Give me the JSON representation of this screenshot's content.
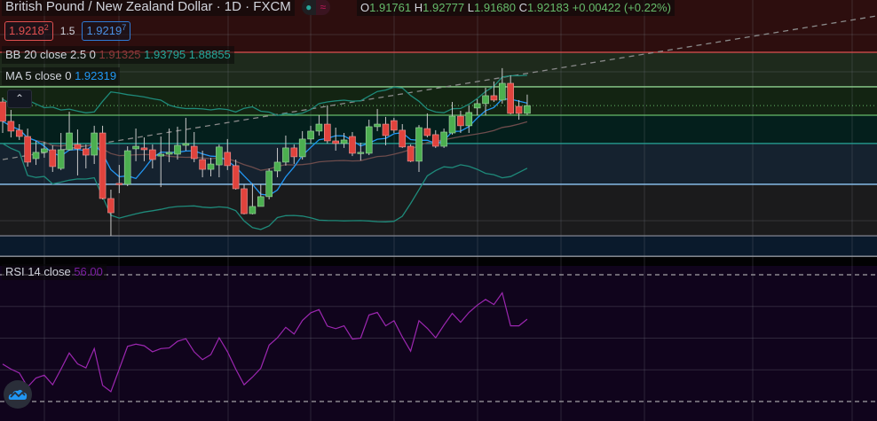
{
  "header": {
    "title": "British Pound / New Zealand Dollar · 1D · FXCM",
    "ohlc": {
      "o_label": "O",
      "o": "1.91761",
      "h_label": "H",
      "h": "1.92777",
      "l_label": "L",
      "l": "1.91680",
      "c_label": "C",
      "c": "1.92183",
      "change": "+0.00422 (+0.22%)"
    }
  },
  "trade": {
    "sell_price": "1.9218",
    "sell_pip": "2",
    "quantity": "1.5",
    "buy_price": "1.9219",
    "buy_pip": "7"
  },
  "indicators": {
    "bb": {
      "label": "BB 20 close 2.5 0",
      "basis": "1.91325",
      "upper": "1.93795",
      "lower": "1.88855"
    },
    "ma": {
      "label": "MA 5 close 0",
      "value": "1.92319"
    },
    "rsi": {
      "label": "RSI 14 close",
      "value": "56.00"
    }
  },
  "colors": {
    "up": "#4caf50",
    "down": "#e0433d",
    "ma": "#2196f3",
    "bb_band": "#1e8a7a",
    "bb_basis": "#6d4c4c",
    "rsi": "#9c27b0"
  },
  "icons": {
    "collapse": "chevron-up-icon",
    "logo": "cloud-chart-icon"
  },
  "chart_data": {
    "type": "candlestick",
    "title": "British Pound / New Zealand Dollar · 1D · FXCM",
    "candles_ohlc": [
      [
        1.9238,
        1.9262,
        1.907,
        1.9133
      ],
      [
        1.9133,
        1.9195,
        1.9046,
        1.908
      ],
      [
        1.9085,
        1.9118,
        1.9032,
        1.9051
      ],
      [
        1.9051,
        1.9094,
        1.8888,
        1.8912
      ],
      [
        1.8931,
        1.9027,
        1.8897,
        1.8965
      ],
      [
        1.8965,
        1.9022,
        1.8936,
        1.8984
      ],
      [
        1.8979,
        1.9003,
        1.8859,
        1.8888
      ],
      [
        1.8878,
        1.907,
        1.8869,
        1.8979
      ],
      [
        1.8979,
        1.9185,
        1.8974,
        1.907
      ],
      [
        1.9008,
        1.9089,
        1.884,
        1.8984
      ],
      [
        1.8984,
        1.9008,
        1.8878,
        1.895
      ],
      [
        1.895,
        1.9109,
        1.8902,
        1.907
      ],
      [
        1.907,
        1.9109,
        1.871,
        1.8715
      ],
      [
        1.8715,
        1.8763,
        1.8513,
        1.8638
      ],
      [
        1.8797,
        1.8897,
        1.8744,
        1.8792
      ],
      [
        1.8792,
        1.8998,
        1.8782,
        1.8974
      ],
      [
        1.8984,
        1.9094,
        1.8917,
        1.8998
      ],
      [
        1.8989,
        1.9046,
        1.8917,
        1.8979
      ],
      [
        1.8979,
        1.9008,
        1.8878,
        1.8926
      ],
      [
        1.8945,
        1.9051,
        1.8777,
        1.8955
      ],
      [
        1.8955,
        1.9094,
        1.8912,
        1.8965
      ],
      [
        1.8955,
        1.9104,
        1.8926,
        1.9003
      ],
      [
        1.9003,
        1.9152,
        1.8974,
        1.9013
      ],
      [
        1.8998,
        1.9075,
        1.8912,
        1.8931
      ],
      [
        1.8926,
        1.8974,
        1.883,
        1.8873
      ],
      [
        1.8873,
        1.8936,
        1.8835,
        1.8902
      ],
      [
        1.8897,
        1.9008,
        1.883,
        1.8994
      ],
      [
        1.8965,
        1.9037,
        1.8869,
        1.8893
      ],
      [
        1.8893,
        1.8926,
        1.8763,
        1.8768
      ],
      [
        1.8768,
        1.8792,
        1.8629,
        1.8633
      ],
      [
        1.8633,
        1.8797,
        1.8629,
        1.8672
      ],
      [
        1.8672,
        1.8792,
        1.8672,
        1.8725
      ],
      [
        1.8725,
        1.8878,
        1.871,
        1.8864
      ],
      [
        1.8864,
        1.8989,
        1.883,
        1.8912
      ],
      [
        1.8912,
        1.9056,
        1.8893,
        1.8989
      ],
      [
        1.8989,
        1.9008,
        1.8902,
        1.8941
      ],
      [
        1.8941,
        1.908,
        1.8926,
        1.9037
      ],
      [
        1.9037,
        1.9109,
        1.9013,
        1.908
      ],
      [
        1.908,
        1.9166,
        1.9056,
        1.9118
      ],
      [
        1.9118,
        1.9219,
        1.9013,
        1.9027
      ],
      [
        1.9027,
        1.9099,
        1.8974,
        1.9013
      ],
      [
        1.9013,
        1.907,
        1.8989,
        1.9032
      ],
      [
        1.9051,
        1.9075,
        1.8945,
        1.896
      ],
      [
        1.896,
        1.9017,
        1.8921,
        1.8965
      ],
      [
        1.896,
        1.9142,
        1.895,
        1.9104
      ],
      [
        1.9104,
        1.92,
        1.908,
        1.9118
      ],
      [
        1.9118,
        1.9157,
        1.9003,
        1.9056
      ],
      [
        1.9137,
        1.9152,
        1.907,
        1.9085
      ],
      [
        1.9085,
        1.9118,
        1.8989,
        1.8994
      ],
      [
        1.8998,
        1.9008,
        1.8912,
        1.8917
      ],
      [
        1.8917,
        1.9113,
        1.8859,
        1.9099
      ],
      [
        1.9094,
        1.9176,
        1.9046,
        1.9056
      ],
      [
        1.9061,
        1.9085,
        1.8989,
        1.8998
      ],
      [
        1.8998,
        1.9094,
        1.8989,
        1.9075
      ],
      [
        1.907,
        1.9238,
        1.9061,
        1.9161
      ],
      [
        1.9161,
        1.919,
        1.907,
        1.9109
      ],
      [
        1.9109,
        1.9219,
        1.907,
        1.9181
      ],
      [
        1.9205,
        1.9253,
        1.9166,
        1.9229
      ],
      [
        1.9229,
        1.9315,
        1.9166,
        1.9272
      ],
      [
        1.9272,
        1.9349,
        1.9238,
        1.9248
      ],
      [
        1.9248,
        1.9421,
        1.9229,
        1.9339
      ],
      [
        1.9339,
        1.9382,
        1.9171,
        1.9176
      ],
      [
        1.9214,
        1.9248,
        1.9142,
        1.9176
      ],
      [
        1.91761,
        1.92777,
        1.9168,
        1.92183
      ]
    ],
    "rsi": [
      41.8,
      40.2,
      39.0,
      34.6,
      37.4,
      38.3,
      35.3,
      40.2,
      45.3,
      41.9,
      40.6,
      46.7,
      35.1,
      33.1,
      40.2,
      47.4,
      48.1,
      47.6,
      45.7,
      46.7,
      46.9,
      49.0,
      49.8,
      45.7,
      43.2,
      44.8,
      50.1,
      45.7,
      40.2,
      35.3,
      37.7,
      40.5,
      47.8,
      50.1,
      53.4,
      51.3,
      55.6,
      58.0,
      59.0,
      53.8,
      53.0,
      53.9,
      49.7,
      50.0,
      57.3,
      58.1,
      53.9,
      55.5,
      50.4,
      45.9,
      55.5,
      53.1,
      50.1,
      54.1,
      57.8,
      55.0,
      58.1,
      60.4,
      62.2,
      60.6,
      64.3,
      53.9,
      53.9,
      56.0
    ],
    "rsi_levels": [
      70,
      30
    ],
    "rsi_grid": [
      60,
      50,
      40
    ],
    "price_levels": [
      {
        "price": 1.9507,
        "color": "#e04f4f"
      },
      {
        "price": 1.932,
        "color": "#8fd18f"
      },
      {
        "price": 1.9166,
        "color": "#66bb6a"
      },
      {
        "price": 1.9013,
        "color": "#26a69a"
      },
      {
        "price": 1.8792,
        "color": "#90caf9"
      },
      {
        "price": 1.8513,
        "color": "#787b86"
      },
      {
        "price": 1.8402,
        "color": "#9598a1"
      }
    ],
    "zones": [
      {
        "from": 2.0,
        "to": 1.9507,
        "color": "#2d0e0e"
      },
      {
        "from": 1.9507,
        "to": 1.932,
        "color": "#1e2a1c"
      },
      {
        "from": 1.932,
        "to": 1.9166,
        "color": "#132412"
      },
      {
        "from": 1.9166,
        "to": 1.9013,
        "color": "#041f1c"
      },
      {
        "from": 1.9013,
        "to": 1.8792,
        "color": "#15222f"
      },
      {
        "from": 1.8792,
        "to": 1.8513,
        "color": "#1b1b1c"
      },
      {
        "from": 1.8513,
        "to": 1.8402,
        "color": "#0a1a2c"
      }
    ],
    "last_price": 1.92183,
    "trendline": {
      "from_bar": 0,
      "from_price": 1.8926,
      "to_bar": 105,
      "to_price": 1.9704
    }
  }
}
